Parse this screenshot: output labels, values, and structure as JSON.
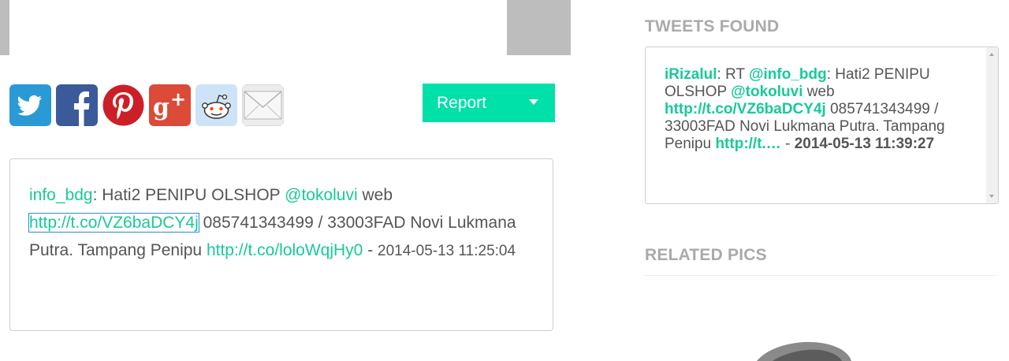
{
  "share": {
    "icons": [
      "twitter-icon",
      "facebook-icon",
      "pinterest-icon",
      "google-plus-icon",
      "reddit-icon",
      "email-icon"
    ]
  },
  "report": {
    "label": "Report"
  },
  "tweet": {
    "user": "info_bdg",
    "sep": ": ",
    "text1": "Hati2 PENIPU OLSHOP ",
    "mention": "@tokoluvi",
    "text2": " web ",
    "link1": "http://t.co/VZ6baDCY4j",
    "text3": " 085741343499 / 33003FAD Novi Lukmana Putra. Tampang Penipu ",
    "link2": "http://t.co/loloWqjHy0",
    "text4": " - ",
    "timestamp": "2014-05-13 11:25:04"
  },
  "sidebar": {
    "tweets_found_title": "TWEETS FOUND",
    "found": {
      "user": "iRizalul",
      "text1": ": RT ",
      "mention1": "@info_bdg",
      "text2": ": Hati2 PENIPU OLSHOP ",
      "mention2": "@tokoluvi",
      "text3": " web ",
      "link1": "http://t.co/VZ6baDCY4j",
      "text4": " 085741343499 / 33003FAD Novi Lukmana Putra. Tampang Penipu ",
      "link2": "http://t.…",
      "text5": " - ",
      "timestamp": "2014-05-13 11:39:27"
    },
    "related_pics_title": "RELATED PICS"
  },
  "colors": {
    "accent": "#00e0a9",
    "link": "#19c99a",
    "heading": "#aaaaaa"
  }
}
